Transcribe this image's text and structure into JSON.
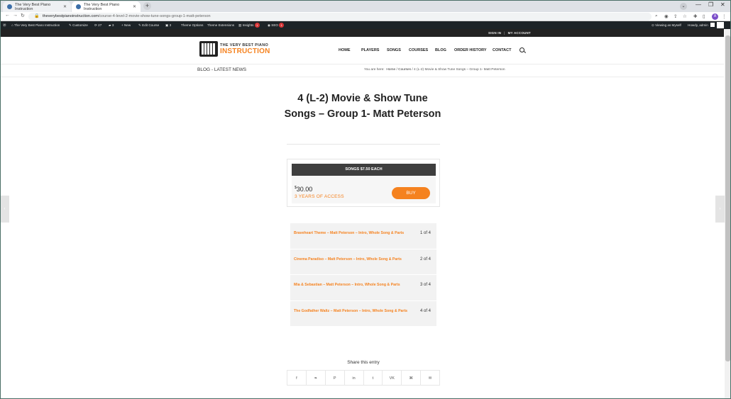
{
  "browser": {
    "tabs": [
      {
        "label": "The Very Best Piano Instruction"
      },
      {
        "label": "The Very Best Piano Instruction"
      }
    ],
    "new_tab": "+",
    "url_host": "theverybestpianoinstruction.com",
    "url_path": "/course-4-level-2-movie-show-tune-songs-group-1-matt-peterson",
    "profile_initial": "A"
  },
  "admin_bar": {
    "site_name": "The Very Best Piano Instruction",
    "customize": "Customize",
    "updates": "27",
    "comments": "3",
    "new": "New",
    "edit_course": "Edit Course",
    "other_count": "3",
    "theme_options": "Theme Options",
    "theme_extensions": "Theme Extensions",
    "insights": "Insights",
    "insights_badge": "1",
    "seo": "SEO",
    "seo_badge": "1",
    "viewing_as": "Viewing as Myself",
    "howdy": "Howdy, admin"
  },
  "topbar": {
    "sign_in": "SIGN IN",
    "my_account": "MY ACCOUNT"
  },
  "logo": {
    "small": "THE VERY BEST PIANO",
    "big": "INSTRUCTION"
  },
  "nav": {
    "items": [
      "HOME",
      "PLAYERS",
      "SONGS",
      "COURSES",
      "BLOG",
      "ORDER HISTORY",
      "CONTACT"
    ]
  },
  "subheader": {
    "blog_title": "BLOG - LATEST NEWS",
    "breadcrumb_prefix": "You are here:",
    "crumb_home": "Home",
    "crumb_courses": "Courses",
    "crumb_current": "4 (L-2) Movie & Show Tune Songs – Group 1- Matt Peterson"
  },
  "course": {
    "title": "4 (L-2) Movie & Show Tune Songs – Group 1- Matt Peterson"
  },
  "pricing": {
    "header": "SONGS $7.50 EACH",
    "currency": "$",
    "amount": "30.00",
    "access": "3 YEARS OF ACCESS",
    "buy_label": "BUY"
  },
  "lessons": [
    {
      "title": "Braveheart Theme – Matt Peterson – Intro, Whole Song & Parts",
      "count": "1 of 4"
    },
    {
      "title": "Cinema Paradiso – Matt Peterson – Intro, Whole Song & Parts",
      "count": "2 of 4"
    },
    {
      "title": "Mia & Sebastian – Matt Peterson – Intro, Whole Song & Parts",
      "count": "3 of 4"
    },
    {
      "title": "The Godfather Waltz – Matt Peterson – Intro, Whole Song & Parts",
      "count": "4 of 4"
    }
  ],
  "share": {
    "title": "Share this entry",
    "buttons": [
      "f",
      "❧",
      "P",
      "in",
      "t",
      "VK",
      "⌘",
      "✉"
    ]
  },
  "colors": {
    "accent": "#f5821f",
    "admin_bar": "#1d2327",
    "price_header": "#3e3e3e"
  }
}
